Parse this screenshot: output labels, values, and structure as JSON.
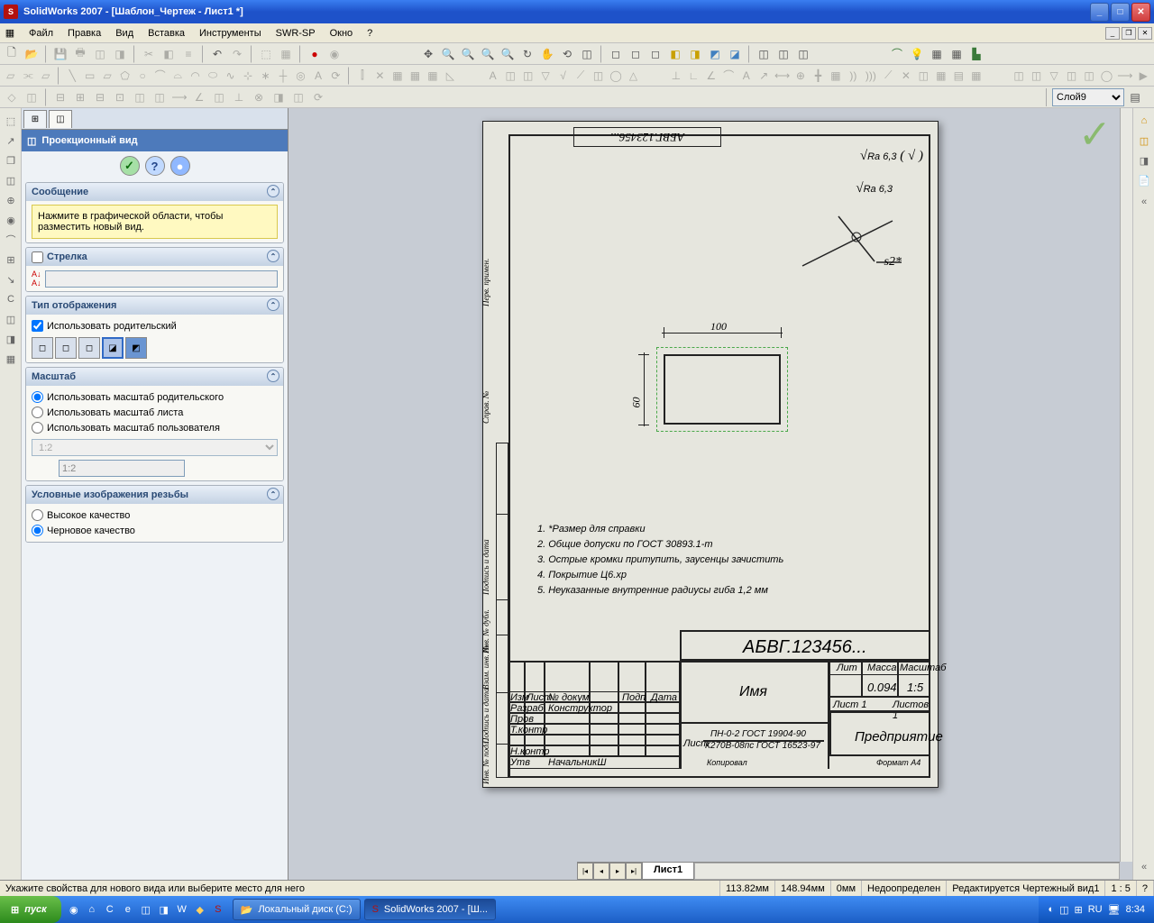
{
  "app": {
    "title": "SolidWorks 2007 - [Шаблон_Чертеж - Лист1 *]"
  },
  "menu": [
    "Файл",
    "Правка",
    "Вид",
    "Вставка",
    "Инструменты",
    "SWR-SP",
    "Окно",
    "?"
  ],
  "layer": {
    "selected": "Слой9"
  },
  "propmgr": {
    "title": "Проекционный вид",
    "message": {
      "header": "Сообщение",
      "text": "Нажмите в графической области, чтобы разместить новый вид."
    },
    "arrow": {
      "header": "Стрелка",
      "checkbox": "",
      "label_input": ""
    },
    "display": {
      "header": "Тип отображения",
      "use_parent": "Использовать родительский"
    },
    "scale": {
      "header": "Масштаб",
      "r1": "Использовать масштаб родительского",
      "r2": "Использовать масштаб листа",
      "r3": "Использовать масштаб пользователя",
      "combo": "1:2",
      "input": "1:2"
    },
    "thread": {
      "header": "Условные изображения резьбы",
      "r1": "Высокое качество",
      "r2": "Черновое качество"
    }
  },
  "sheet": {
    "tab": "Лист1",
    "dim_w": "100",
    "dim_h": "60",
    "ra1": "Ra 6,3",
    "ra2": "Ra 6,3",
    "s2": "s2*",
    "notes": [
      "1.    *Размер для справки",
      "2.    Общие допуски по ГОСТ 30893.1-m",
      "3.    Острые кромки притупить, заусенцы зачистить",
      "4.    Покрытие Ц6.хр",
      "5.    Неуказанные внутренние радиусы гиба 1,2 мм"
    ],
    "tb": {
      "designation": "АБВГ.123456...",
      "name": "Имя",
      "razrab": "Разраб",
      "konstr": "Конструктор",
      "prov": "Пров",
      "tkontr": "Т.контр",
      "nkontr": "Н.контр",
      "utv": "Утв",
      "nachalnik": "НачальникШ",
      "izm": "Изм",
      "list_h": "Лист",
      "ndoku": "№ докум",
      "podp": "Подп",
      "data": "Дата",
      "lit": "Лит",
      "massa": "Масса",
      "masshtab": "Масштаб",
      "massa_v": "0.094",
      "masshtab_v": "1:5",
      "list1": "Лист 1",
      "listov": "Листов 1",
      "predpr": "Предприятие",
      "list_lbl": "Лист",
      "mat1": "ПН-0-2 ГОСТ 19904-90",
      "mat2": "К270В-08пс ГОСТ 16523-97",
      "kopir": "Копировал",
      "format": "Формат А4",
      "top_des": "АБВГ.123456..."
    }
  },
  "status": {
    "prompt": "Укажите свойства для нового вида или выберите место для него",
    "x": "113.82мм",
    "y": "148.94мм",
    "z": "0мм",
    "def": "Недоопределен",
    "edit": "Редактируется Чертежный вид1",
    "scale": "1 : 5"
  },
  "taskbar": {
    "start": "пуск",
    "t1": "Локальный диск (C:)",
    "t2": "SolidWorks 2007 - [Ш...",
    "lang": "RU",
    "time": "8:34"
  }
}
